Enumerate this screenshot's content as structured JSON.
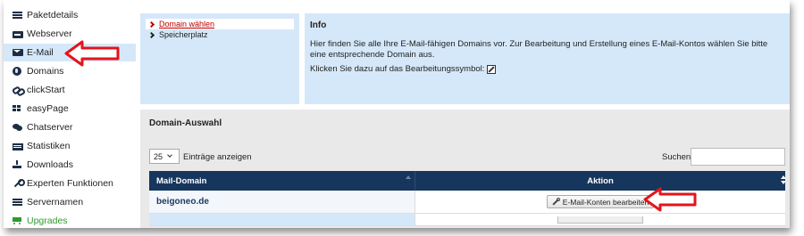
{
  "sidebar": {
    "items": [
      {
        "label": "Paketdetails",
        "icon": "list-icon"
      },
      {
        "label": "Webserver",
        "icon": "server-icon"
      },
      {
        "label": "E-Mail",
        "icon": "envelope-icon",
        "active": true
      },
      {
        "label": "Domains",
        "icon": "globe-icon"
      },
      {
        "label": "clickStart",
        "icon": "link-icon"
      },
      {
        "label": "easyPage",
        "icon": "grid-icon"
      },
      {
        "label": "Chatserver",
        "icon": "chat-icon"
      },
      {
        "label": "Statistiken",
        "icon": "bars-icon"
      },
      {
        "label": "Downloads",
        "icon": "download-icon"
      },
      {
        "label": "Experten Funktionen",
        "icon": "wrench-icon"
      },
      {
        "label": "Servernamen",
        "icon": "rows-icon"
      },
      {
        "label": "Upgrades",
        "icon": "cart-icon"
      }
    ]
  },
  "subnav": {
    "items": [
      {
        "label": "Domain wählen",
        "selected": true
      },
      {
        "label": "Speicherplatz",
        "selected": false
      }
    ]
  },
  "info": {
    "title": "Info",
    "text": "Hier finden Sie alle Ihre E-Mail-fähigen Domains vor. Zur Bearbeitung und Erstellung eines E-Mail-Kontos wählen Sie bitte eine entsprechende Domain aus.",
    "text2": "Klicken Sie dazu auf das Bearbeitungssymbol:"
  },
  "domain_section": {
    "title": "Domain-Auswahl",
    "page_length": "25",
    "page_length_label": "Einträge anzeigen",
    "search_label": "Suchen",
    "search_value": "",
    "columns": [
      "Mail-Domain",
      "Aktion"
    ],
    "rows": [
      {
        "domain": "beigoneo.de",
        "action_label": "E-Mail-Konten bearbeiten"
      }
    ]
  },
  "colors": {
    "accent_light_blue": "#d5e8f9",
    "table_header": "#17365d",
    "annotation_red": "#e2151b",
    "upgrade_green": "#2e9b2e"
  }
}
